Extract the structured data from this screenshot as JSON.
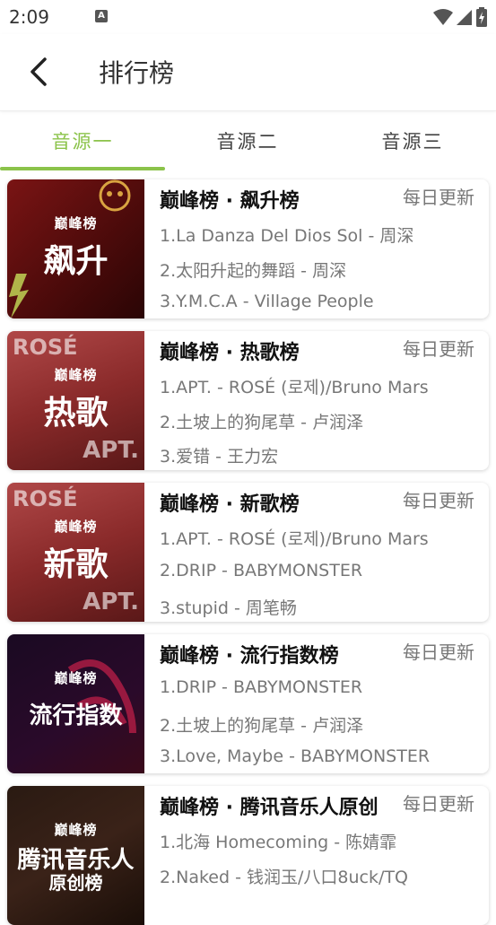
{
  "status_bar": {
    "time": "2:09",
    "notif_icon": "A"
  },
  "header": {
    "title": "排行榜"
  },
  "tabs": [
    {
      "label": "音源一",
      "active": true
    },
    {
      "label": "音源二",
      "active": false
    },
    {
      "label": "音源三",
      "active": false
    }
  ],
  "colors": {
    "accent": "#8bc34a"
  },
  "charts": [
    {
      "title": "巅峰榜 · 飙升榜",
      "update": "每日更新",
      "cover_brand": "巅峰榜",
      "cover_label": "飙升",
      "songs": [
        "1.La Danza Del Dios Sol - 周深",
        "2.太阳升起的舞蹈 - 周深",
        "3.Y.M.C.A - Village People"
      ]
    },
    {
      "title": "巅峰榜 · 热歌榜",
      "update": "每日更新",
      "cover_brand": "巅峰榜",
      "cover_label": "热歌",
      "cover_text_top": "ROSÉ",
      "cover_text_bottom": "APT.",
      "songs": [
        "1.APT. - ROSÉ (로제)/Bruno Mars",
        "2.土坡上的狗尾草 - 卢润泽",
        "3.爱错 - 王力宏"
      ]
    },
    {
      "title": "巅峰榜 · 新歌榜",
      "update": "每日更新",
      "cover_brand": "巅峰榜",
      "cover_label": "新歌",
      "cover_text_top": "ROSÉ",
      "cover_text_bottom": "APT.",
      "songs": [
        "1.APT. - ROSÉ (로제)/Bruno Mars",
        "2.DRIP - BABYMONSTER",
        "3.stupid - 周笔畅"
      ]
    },
    {
      "title": "巅峰榜 · 流行指数榜",
      "update": "每日更新",
      "cover_brand": "巅峰榜",
      "cover_label": "流行指数",
      "songs": [
        "1.DRIP - BABYMONSTER",
        "2.土坡上的狗尾草 - 卢润泽",
        "3.Love, Maybe - BABYMONSTER"
      ]
    },
    {
      "title": "巅峰榜 · 腾讯音乐人原创",
      "update": "每日更新",
      "cover_brand": "巅峰榜",
      "cover_label": "腾讯音乐人",
      "cover_label_2": "原创榜",
      "songs": [
        "1.北海 Homecoming - 陈婧霏",
        "2.Naked - 钱润玉/八口8uck/TQ",
        ""
      ]
    }
  ]
}
